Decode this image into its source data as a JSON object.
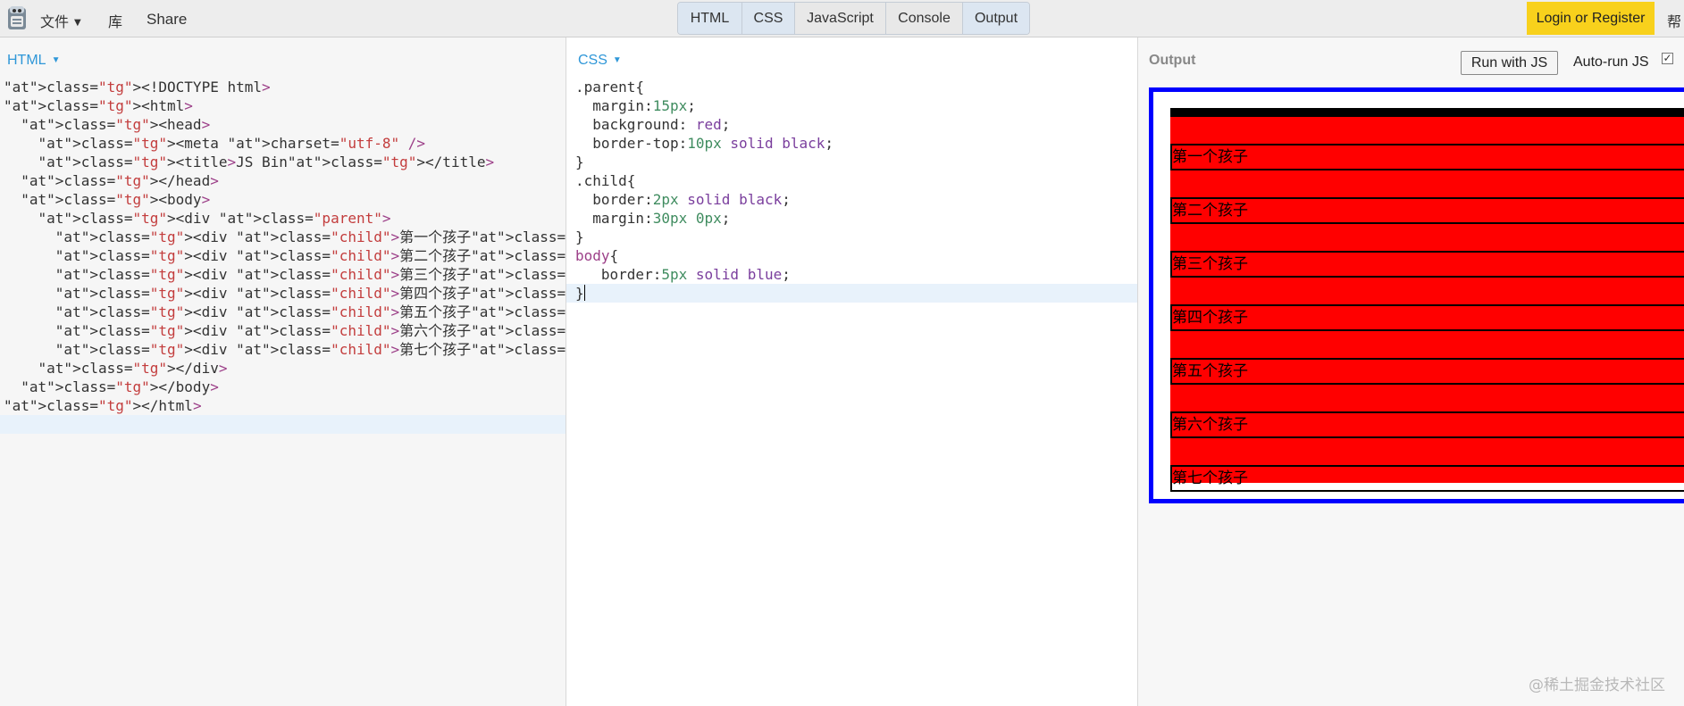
{
  "topbar": {
    "menu_file": "文件",
    "menu_library": "库",
    "menu_share": "Share",
    "tabs": [
      "HTML",
      "CSS",
      "JavaScript",
      "Console",
      "Output"
    ],
    "login": "Login or Register",
    "help": "帮"
  },
  "html_panel": {
    "label": "HTML",
    "code": [
      "<!DOCTYPE html>",
      "<html>",
      "  <head>",
      "    <meta charset=\"utf-8\" />",
      "    <title>JS Bin</title>",
      "  </head>",
      "  <body>",
      "    <div class=\"parent\">",
      "      <div class=\"child\">第一个孩子</div>",
      "      <div class=\"child\">第二个孩子</div>",
      "      <div class=\"child\">第三个孩子</div>",
      "      <div class=\"child\">第四个孩子</div>",
      "      <div class=\"child\">第五个孩子</div>",
      "      <div class=\"child\">第六个孩子</div>",
      "      <div class=\"child\">第七个孩子</div>",
      "    </div>",
      "  </body>",
      "</html>"
    ]
  },
  "css_panel": {
    "label": "CSS",
    "code": [
      ".parent{",
      "  margin:15px;",
      "  background: red;",
      "  border-top:10px solid black;",
      "}",
      ".child{",
      "  border:2px solid black;",
      "  margin:30px 0px;",
      "}",
      "body{",
      "   border:5px solid blue;",
      "}"
    ]
  },
  "output_panel": {
    "label": "Output",
    "run_button": "Run with JS",
    "autorun_label": "Auto-run JS",
    "autorun_checked": true,
    "children": [
      "第一个孩子",
      "第二个孩子",
      "第三个孩子",
      "第四个孩子",
      "第五个孩子",
      "第六个孩子",
      "第七个孩子"
    ]
  },
  "watermark": "@稀土掘金技术社区",
  "colors": {
    "accent_blue": "#2f97d8",
    "login_yellow": "#f8d11c",
    "output_border": "#0000ff",
    "parent_bg": "#ff0000"
  }
}
